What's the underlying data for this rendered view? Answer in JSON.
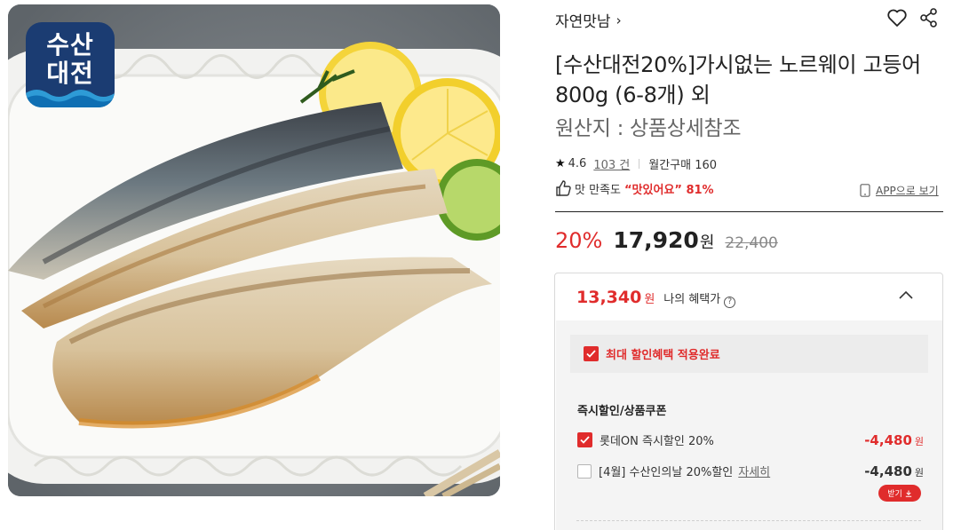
{
  "image_badge": {
    "line1": "수산",
    "line2": "대전"
  },
  "brand": {
    "name": "자연맛남",
    "chevron": "›"
  },
  "icons": {
    "heart": "heart-icon",
    "share": "share-icon",
    "star": "star-icon",
    "thumb": "thumbs-up-icon",
    "phone": "phone-icon"
  },
  "product": {
    "title": "[수산대전20%]가시없는 노르웨이 고등어 800g (6-8개) 외",
    "origin": "원산지 : 상품상세참조"
  },
  "stats": {
    "star": "★",
    "rating": "4.6",
    "reviews": "103 건",
    "monthly": "월간구매 160"
  },
  "taste": {
    "label": "맛 만족도",
    "highlight": "“맛있어요” 81%"
  },
  "app_link": "APP으로 보기",
  "price": {
    "discount": "20%",
    "sale": "17,920",
    "won": "원",
    "original": "22,400"
  },
  "benefit": {
    "my_price": "13,340",
    "won": "원",
    "label": "나의 혜택가",
    "help": "?",
    "max_label": "최대 할인혜택 적용완료",
    "section_title": "즉시할인/상품쿠폰",
    "items": [
      {
        "label": "롯데ON 즉시할인 20%",
        "amount": "-4,480",
        "won": "원",
        "checked": true
      },
      {
        "label": "[4월] 수산인의날 20%할인",
        "detail": "자세히",
        "amount": "-4,480",
        "won": "원",
        "checked": false
      }
    ],
    "get_button": "받기"
  },
  "colors": {
    "accent": "#e02c2c",
    "badge": "#1b3c72",
    "text": "#222222"
  }
}
